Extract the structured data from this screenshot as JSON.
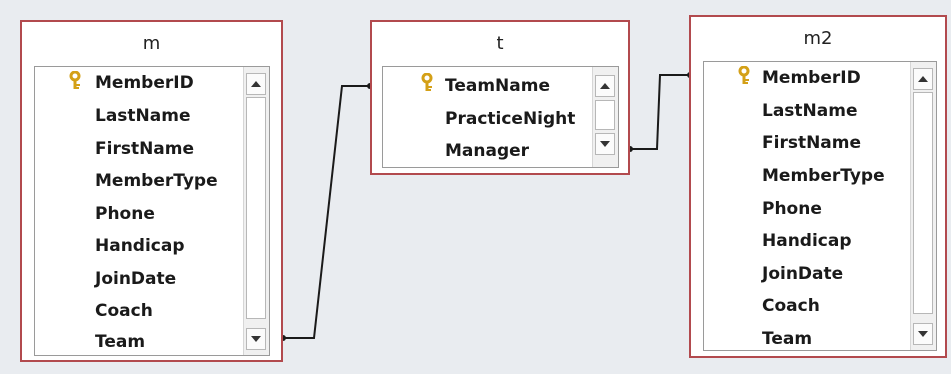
{
  "tables": {
    "m": {
      "title": "m",
      "fields": [
        "MemberID",
        "LastName",
        "FirstName",
        "MemberType",
        "Phone",
        "Handicap",
        "JoinDate",
        "Coach",
        "Team"
      ],
      "primary_key": "MemberID"
    },
    "t": {
      "title": "t",
      "fields": [
        "TeamName",
        "PracticeNight",
        "Manager"
      ],
      "primary_key": "TeamName"
    },
    "m2": {
      "title": "m2",
      "fields": [
        "MemberID",
        "LastName",
        "FirstName",
        "MemberType",
        "Phone",
        "Handicap",
        "JoinDate",
        "Coach",
        "Team"
      ],
      "primary_key": "MemberID"
    }
  },
  "relationships": [
    {
      "from": "m.Team",
      "to": "t.TeamName"
    },
    {
      "from": "t.Manager",
      "to": "m2.MemberID"
    }
  ],
  "colors": {
    "table_border": "#b24a4e",
    "canvas": "#e9ecf0",
    "key_icon": "#d4a017"
  },
  "icons": {
    "primary_key": "key-icon",
    "scroll_up": "triangle-up-icon",
    "scroll_down": "triangle-down-icon"
  }
}
